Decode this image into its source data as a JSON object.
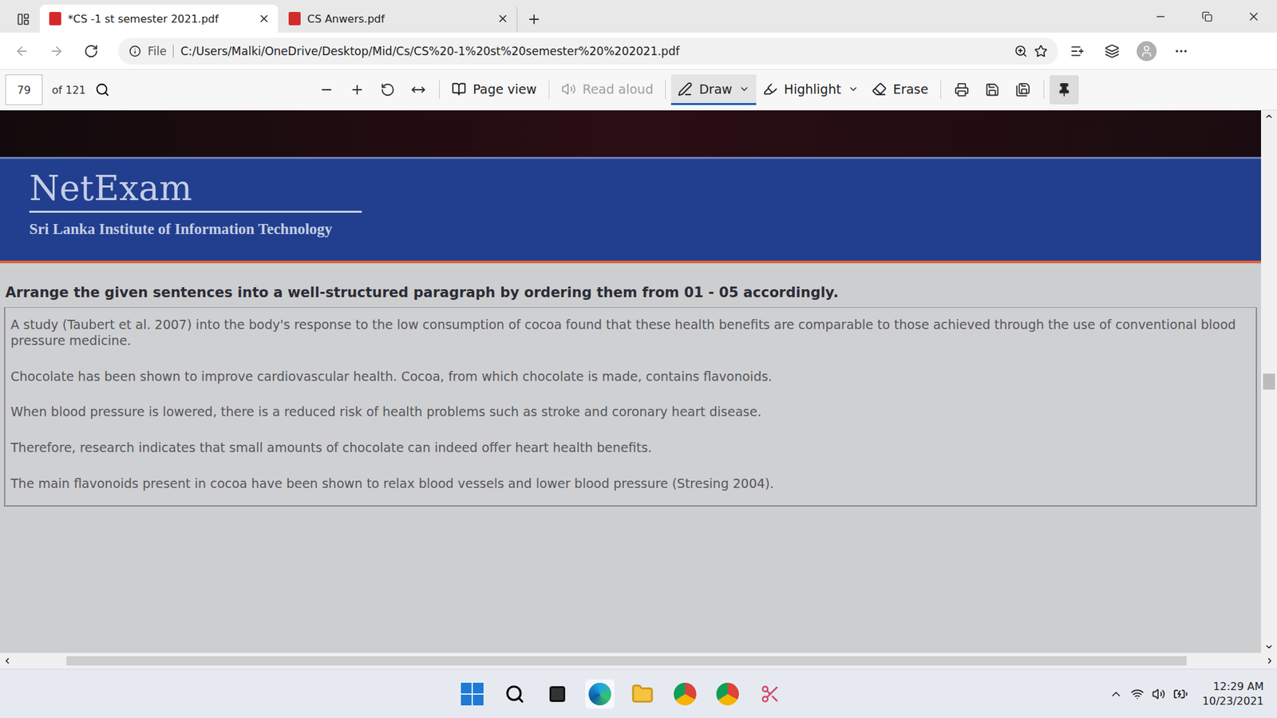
{
  "window": {
    "tabs": [
      {
        "title": "*CS -1 st semester 2021.pdf",
        "selected": true
      },
      {
        "title": "CS Anwers.pdf",
        "selected": false
      }
    ]
  },
  "address": {
    "prefix": "File",
    "url": "C:/Users/Malki/OneDrive/Desktop/Mid/Cs/CS%20-1%20st%20semester%20%202021.pdf"
  },
  "pdf_toolbar": {
    "page": "79",
    "page_count": "of 121",
    "tools": [
      {
        "label": "Page view",
        "selected": false,
        "disabled": false
      },
      {
        "label": "Read aloud",
        "selected": false,
        "disabled": true
      },
      {
        "label": "Draw",
        "selected": true,
        "disabled": false
      },
      {
        "label": "Highlight",
        "selected": false,
        "disabled": false
      },
      {
        "label": "Erase",
        "selected": false,
        "disabled": false
      }
    ]
  },
  "document": {
    "header_title": "NetExam",
    "header_subtitle": "Sri Lanka Institute of Information Technology",
    "question": "Arrange the given sentences into a well-structured paragraph by ordering them from 01 - 05 accordingly.",
    "sentences": [
      "A study (Taubert et al. 2007) into the body's response to the low consumption of cocoa found that these health benefits are comparable to those achieved through the use of conventional blood pressure medicine.",
      "Chocolate has been shown to improve cardiovascular health. Cocoa, from which chocolate is made, contains flavonoids.",
      "When blood pressure is lowered, there is a reduced risk of health problems such as stroke and coronary heart disease.",
      "Therefore, research indicates that small amounts of chocolate can indeed offer heart health benefits.",
      "The main flavonoids present in cocoa have been shown to relax blood vessels and lower blood pressure (Stresing 2004)."
    ]
  },
  "taskbar": {
    "time": "12:29 AM",
    "date": "10/23/2021"
  }
}
